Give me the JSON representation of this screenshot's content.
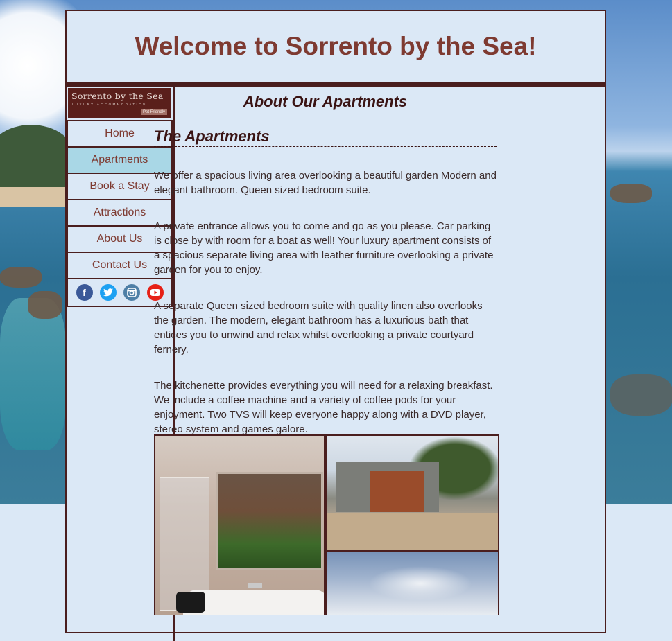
{
  "header": {
    "title": "Welcome to Sorrento by the Sea!"
  },
  "logo": {
    "title": "Sorrento by the Sea",
    "subtitle": "LUXURY ACCOMMODATION",
    "tag": "Pet Friendly"
  },
  "nav": {
    "items": [
      {
        "label": "Home",
        "active": false
      },
      {
        "label": "Apartments",
        "active": true
      },
      {
        "label": "Book a Stay",
        "active": false
      },
      {
        "label": "Attractions",
        "active": false
      },
      {
        "label": "About Us",
        "active": false
      },
      {
        "label": "Contact Us",
        "active": false
      }
    ],
    "active_color": "#a9d7e6"
  },
  "social": {
    "icons": [
      "facebook-icon",
      "twitter-icon",
      "instagram-icon",
      "youtube-icon"
    ]
  },
  "content": {
    "heading": "About Our Apartments",
    "subheading": "The Apartments",
    "paragraphs": [
      "We offer a spacious living area overlooking a beautiful garden Modern and elegant bathroom. Queen sized bedroom suite.",
      "A private entrance allows you to come and go as you please. Car parking is close by with room for a boat as well! Your luxury apartment consists of a spacious separate living area with leather furniture overlooking a private garden for you to enjoy.",
      "A separate Queen sized bedroom suite with quality linen also overlooks the garden. The modern, elegant bathroom has a luxurious bath that entices you to unwind and relax whilst overlooking a private courtyard fernery.",
      "The kitchenette provides everything you will need for a relaxing breakfast. We include a coffee machine and a variety of coffee pods for your enjoyment. Two TVS will keep everyone happy along with a DVD player, stereo system and games galore."
    ]
  },
  "colors": {
    "title": "#7e3a31",
    "border": "#4a1e1e",
    "page_bg": "#dbe8f6"
  }
}
